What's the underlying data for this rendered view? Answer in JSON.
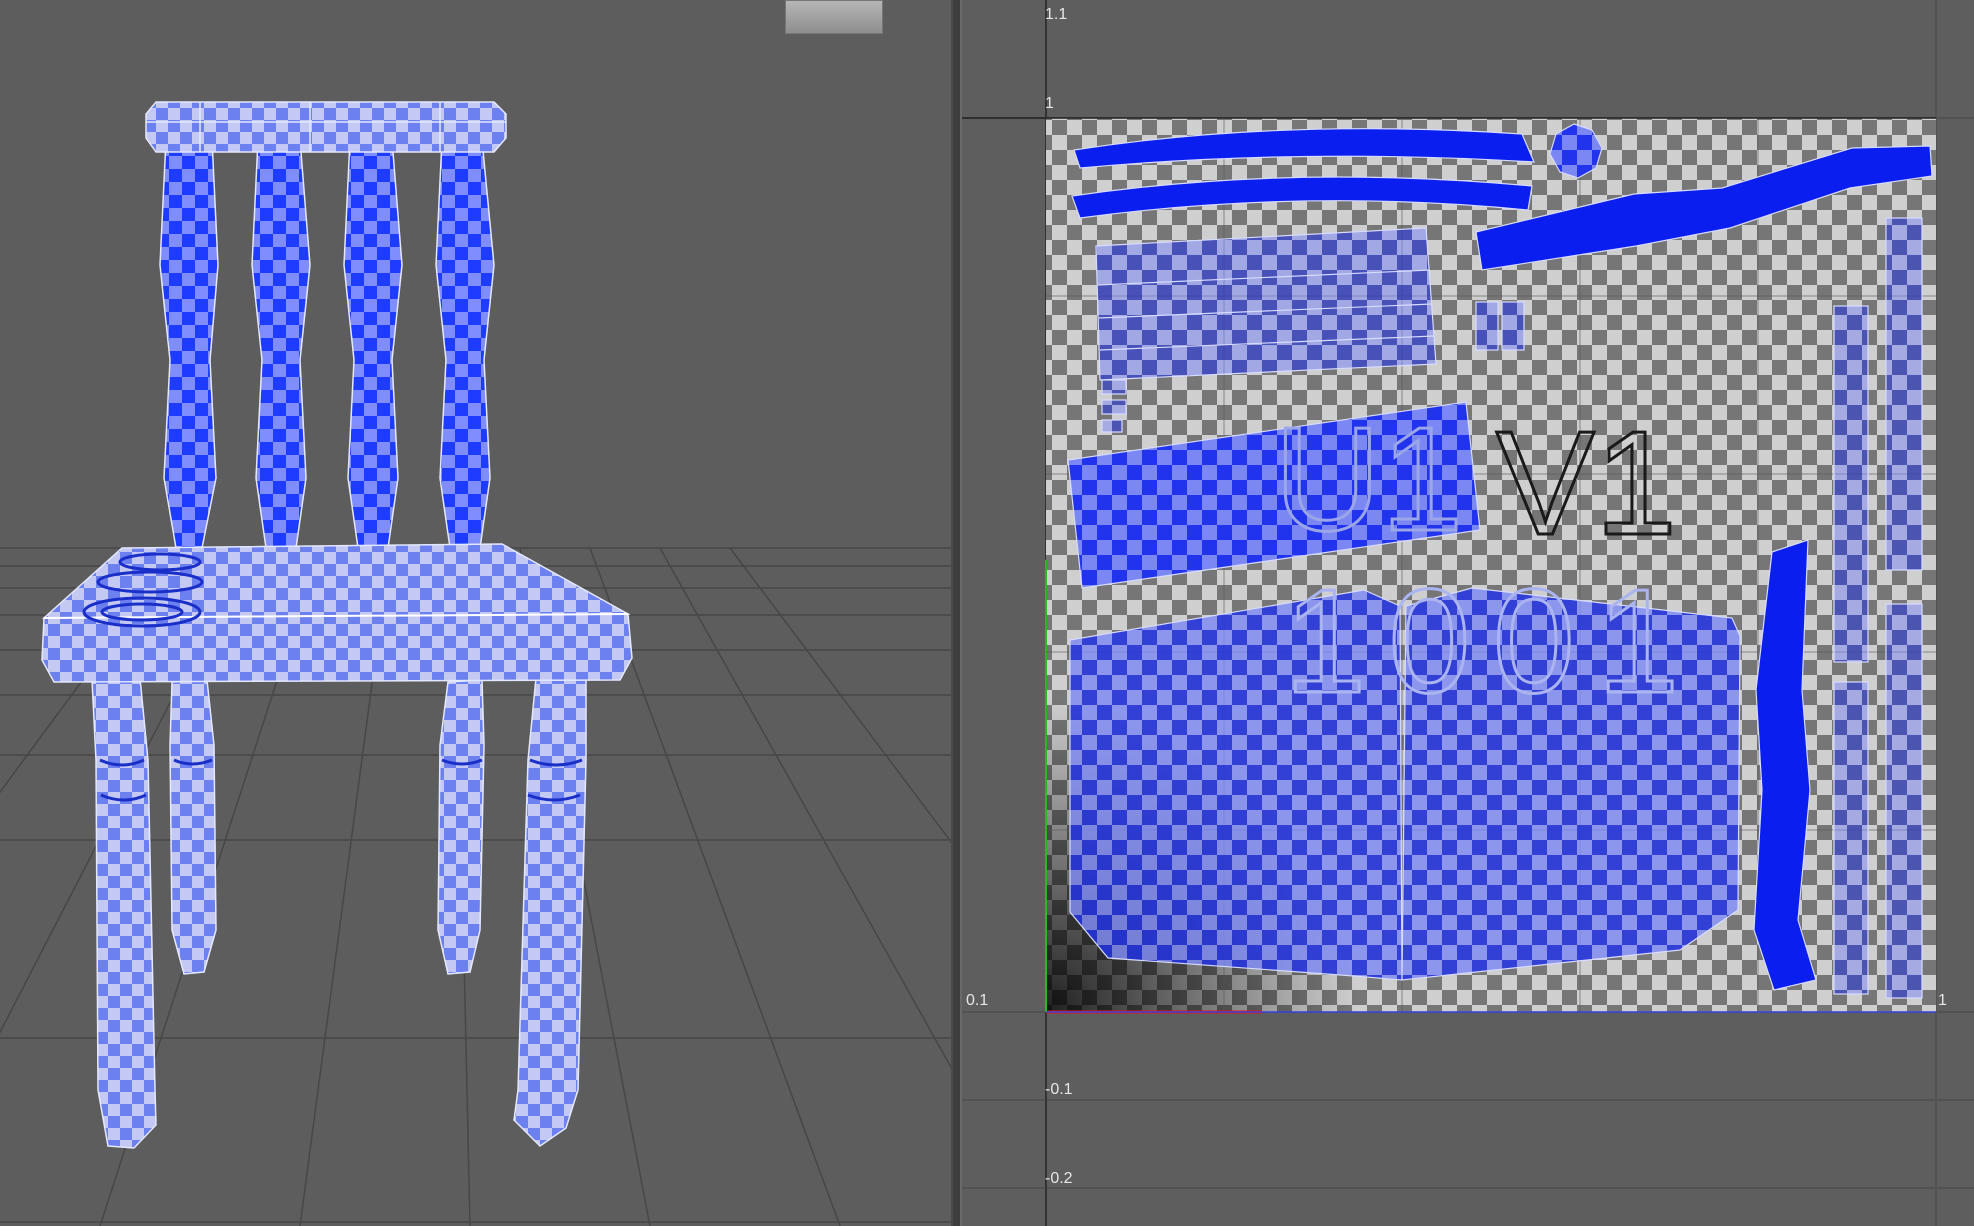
{
  "uv_editor": {
    "axis_labels": {
      "v_1_1": "1.1",
      "v_1": "1",
      "u_0_1": "0.1",
      "u_1": "1",
      "v_neg_0_1": "-0.1",
      "v_neg_0_2": "-0.2"
    },
    "tile_text": {
      "u_label": "U1",
      "v_label": "V1",
      "tile_number": "1001"
    }
  },
  "colors": {
    "uv_shell_fill": "#0a1ef0",
    "viewport_background": "#5d5d5d",
    "grid_line": "#4a4a4a",
    "checker_light": "#c8c8c8",
    "checker_dark": "#6e6e6e"
  }
}
